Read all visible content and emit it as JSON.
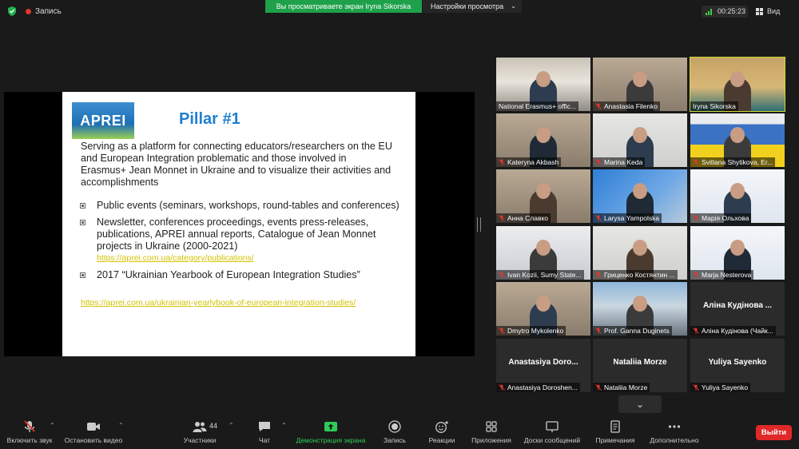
{
  "topbar": {
    "record_label": "Запись",
    "banner": "Вы просматриваете экран Iryna Sikorska",
    "view_settings": "Настройки просмотра",
    "timer": "00:25:23",
    "view_label": "Вид"
  },
  "slide": {
    "logo_text": "APREI",
    "title": "Pillar #1",
    "intro": "Serving as a platform for connecting educators/researchers on the EU and European Integration problematic and those involved in Erasmus+ Jean Monnet in Ukraine and to visualize their activities and accomplishments",
    "bullets": [
      "Public events (seminars, workshops, round-tables and conferences)",
      "Newsletter, conferences proceedings, events press-releases, publications, APREI annual reports, Catalogue of Jean Monnet projects in Ukraine (2000-2021)",
      "2017 “Ukrainian Yearbook  of European Integration Studies”"
    ],
    "link1": "https://aprei.com.ua/category/publications/",
    "link2": "https://aprei.com.ua/ukrainian-yearlybook-of-european-integration-studies/"
  },
  "participants": [
    {
      "name": "National Erasmus+ offic...",
      "muted": false,
      "style": "room"
    },
    {
      "name": "Anastasia Filenko",
      "muted": true,
      "style": "indoor"
    },
    {
      "name": "Iryna Sikorska",
      "muted": false,
      "style": "teal",
      "active": true
    },
    {
      "name": "Kateryna Akbash",
      "muted": true,
      "style": "indoor"
    },
    {
      "name": "Marina Keda",
      "muted": true,
      "style": "light"
    },
    {
      "name": "Svitlana Shytikova, Er...",
      "muted": true,
      "style": "flag"
    },
    {
      "name": "Анна Славко",
      "muted": true,
      "style": "indoor"
    },
    {
      "name": "Larysa Yampolska",
      "muted": true,
      "style": "map"
    },
    {
      "name": "Марія Ольхова",
      "muted": true,
      "style": "slide"
    },
    {
      "name": "Ivan Kozii, Sumy State...",
      "muted": true,
      "style": "office"
    },
    {
      "name": "Гриценко Костянтин ...",
      "muted": true,
      "style": "light"
    },
    {
      "name": "Marja Nesterova",
      "muted": true,
      "style": "slide"
    },
    {
      "name": "Dmytro Mykolenko",
      "muted": true,
      "style": "indoor"
    },
    {
      "name": "Prof. Ganna Duginets",
      "muted": true,
      "style": "building"
    },
    {
      "name": "Аліна Кудінова (Чайк...",
      "muted": true,
      "style": "blank",
      "big": "Аліна Кудінова ..."
    },
    {
      "name": "Anastasiya Doroshen...",
      "muted": true,
      "style": "blank",
      "big": "Anastasiya Doro..."
    },
    {
      "name": "Nataliia Morze",
      "muted": true,
      "style": "blank",
      "big": "Nataliia Morze"
    },
    {
      "name": "Yuliya Sayenko",
      "muted": true,
      "style": "blank",
      "big": "Yuliya Sayenko"
    }
  ],
  "toolbar": {
    "unmute": "Включить звук",
    "start_video": "Остановить видео",
    "participants": "Участники",
    "participants_count": "44",
    "chat": "Чат",
    "share": "Демонстрация экрана",
    "record": "Запись",
    "reactions": "Реакции",
    "apps": "Приложения",
    "whiteboards": "Доски сообщений",
    "notes": "Примечания",
    "more": "Дополнительно",
    "leave": "Выйти"
  },
  "colors": {
    "accent_green": "#1ea14a",
    "leave_red": "#e02828",
    "active_outline": "#cfd833",
    "muted_mic": "#e0362f"
  }
}
